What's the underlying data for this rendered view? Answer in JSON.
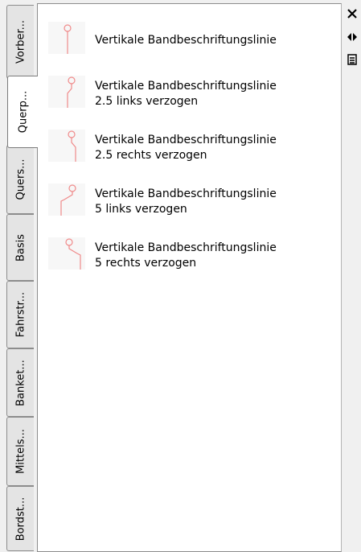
{
  "tabs": [
    {
      "label": "Vorber..."
    },
    {
      "label": "Querp..."
    },
    {
      "label": "Quers..."
    },
    {
      "label": "Basis"
    },
    {
      "label": "Fahrstr..."
    },
    {
      "label": "Banket..."
    },
    {
      "label": "Mittels..."
    },
    {
      "label": "Bordst..."
    }
  ],
  "active_tab": "Querp...",
  "tools": [
    {
      "line1": "Vertikale Bandbeschriftungslinie",
      "line2": "",
      "icon": "vertical-label-line-icon"
    },
    {
      "line1": "Vertikale Bandbeschriftungslinie",
      "line2": "2.5 links verzogen",
      "icon": "label-line-offset-left-2-5-icon"
    },
    {
      "line1": "Vertikale Bandbeschriftungslinie",
      "line2": "2.5 rechts verzogen",
      "icon": "label-line-offset-right-2-5-icon"
    },
    {
      "line1": "Vertikale Bandbeschriftungslinie",
      "line2": "5 links verzogen",
      "icon": "label-line-offset-left-5-icon"
    },
    {
      "line1": "Vertikale Bandbeschriftungslinie",
      "line2": "5 rechts verzogen",
      "icon": "label-line-offset-right-5-icon"
    }
  ],
  "palette_controls": {
    "close_icon": "close-icon",
    "autohide_icon": "auto-hide-icon",
    "properties_icon": "properties-menu-icon"
  },
  "colors": {
    "icon_stroke": "#f08a8a",
    "panel_bg": "#ffffff",
    "chrome_bg": "#f0f0f0"
  }
}
